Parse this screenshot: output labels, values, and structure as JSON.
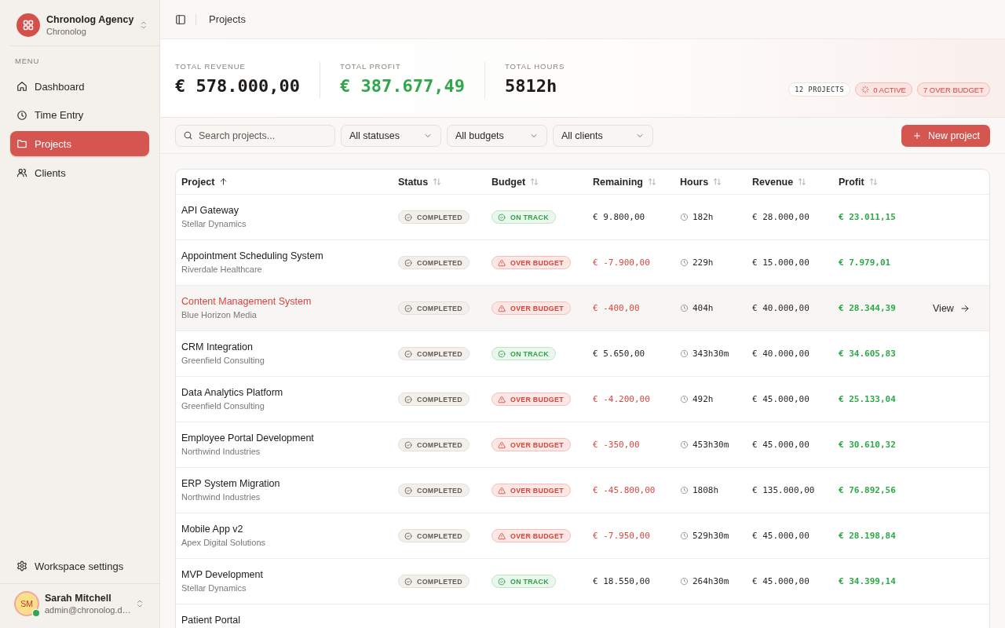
{
  "sidebar": {
    "workspace": {
      "name": "Chronolog Agency",
      "subtitle": "Chronolog"
    },
    "section_label": "MENU",
    "items": [
      {
        "label": "Dashboard",
        "selected": false
      },
      {
        "label": "Time Entry",
        "selected": false
      },
      {
        "label": "Projects",
        "selected": true
      },
      {
        "label": "Clients",
        "selected": false
      }
    ],
    "settings_label": "Workspace settings",
    "user": {
      "initials": "SM",
      "name": "Sarah Mitchell",
      "email": "admin@chronolog.d…",
      "online": true
    }
  },
  "header": {
    "title": "Projects"
  },
  "stats": [
    {
      "label": "TOTAL REVENUE",
      "value": "€ 578.000,00",
      "kind": "neutral"
    },
    {
      "label": "TOTAL PROFIT",
      "value": "€ 387.677,49",
      "kind": "positive"
    },
    {
      "label": "TOTAL HOURS",
      "value": "5812h",
      "kind": "neutral"
    }
  ],
  "summary_badges": [
    {
      "label": "12 PROJECTS",
      "kind": "count"
    },
    {
      "label": "0 ACTIVE",
      "kind": "active"
    },
    {
      "label": "7 OVER BUDGET",
      "kind": "over_budget"
    }
  ],
  "filters": {
    "search": {
      "placeholder": "Search projects..."
    },
    "selects": [
      "All statuses",
      "All budgets",
      "All clients"
    ],
    "new_button": "New project"
  },
  "table": {
    "columns": [
      {
        "label": "Project",
        "sorted": true
      },
      {
        "label": "Status",
        "sorted": false
      },
      {
        "label": "Budget",
        "sorted": false
      },
      {
        "label": "Remaining",
        "sorted": false
      },
      {
        "label": "Hours",
        "sorted": false
      },
      {
        "label": "Revenue",
        "sorted": false
      },
      {
        "label": "Profit",
        "sorted": false
      }
    ],
    "rows": [
      {
        "name": "API Gateway",
        "client": "Stellar Dynamics",
        "status": {
          "label": "COMPLETED",
          "kind": "completed"
        },
        "budget": {
          "label": "ON TRACK",
          "kind": "on_track"
        },
        "remaining": "€ 9.800,00",
        "hours": "182h",
        "revenue": "€ 28.000,00",
        "profit": "€ 23.011,15",
        "hovered": false
      },
      {
        "name": "Appointment Scheduling System",
        "client": "Riverdale Healthcare",
        "status": {
          "label": "COMPLETED",
          "kind": "completed"
        },
        "budget": {
          "label": "OVER BUDGET",
          "kind": "over_budget"
        },
        "remaining": "€ -7.900,00",
        "hours": "229h",
        "revenue": "€ 15.000,00",
        "profit": "€ 7.979,01",
        "hovered": false
      },
      {
        "name": "Content Management System",
        "client": "Blue Horizon Media",
        "status": {
          "label": "COMPLETED",
          "kind": "completed"
        },
        "budget": {
          "label": "OVER BUDGET",
          "kind": "over_budget"
        },
        "remaining": "€ -400,00",
        "hours": "404h",
        "revenue": "€ 40.000,00",
        "profit": "€ 28.344,39",
        "hovered": true,
        "action": "View"
      },
      {
        "name": "CRM Integration",
        "client": "Greenfield Consulting",
        "status": {
          "label": "COMPLETED",
          "kind": "completed"
        },
        "budget": {
          "label": "ON TRACK",
          "kind": "on_track"
        },
        "remaining": "€ 5.650,00",
        "hours": "343h30m",
        "revenue": "€ 40.000,00",
        "profit": "€ 34.605,83",
        "hovered": false
      },
      {
        "name": "Data Analytics Platform",
        "client": "Greenfield Consulting",
        "status": {
          "label": "COMPLETED",
          "kind": "completed"
        },
        "budget": {
          "label": "OVER BUDGET",
          "kind": "over_budget"
        },
        "remaining": "€ -4.200,00",
        "hours": "492h",
        "revenue": "€ 45.000,00",
        "profit": "€ 25.133,04",
        "hovered": false
      },
      {
        "name": "Employee Portal Development",
        "client": "Northwind Industries",
        "status": {
          "label": "COMPLETED",
          "kind": "completed"
        },
        "budget": {
          "label": "OVER BUDGET",
          "kind": "over_budget"
        },
        "remaining": "€ -350,00",
        "hours": "453h30m",
        "revenue": "€ 45.000,00",
        "profit": "€ 30.610,32",
        "hovered": false
      },
      {
        "name": "ERP System Migration",
        "client": "Northwind Industries",
        "status": {
          "label": "COMPLETED",
          "kind": "completed"
        },
        "budget": {
          "label": "OVER BUDGET",
          "kind": "over_budget"
        },
        "remaining": "€ -45.800,00",
        "hours": "1808h",
        "revenue": "€ 135.000,00",
        "profit": "€ 76.892,56",
        "hovered": false
      },
      {
        "name": "Mobile App v2",
        "client": "Apex Digital Solutions",
        "status": {
          "label": "COMPLETED",
          "kind": "completed"
        },
        "budget": {
          "label": "OVER BUDGET",
          "kind": "over_budget"
        },
        "remaining": "€ -7.950,00",
        "hours": "529h30m",
        "revenue": "€ 45.000,00",
        "profit": "€ 28.198,84",
        "hovered": false
      },
      {
        "name": "MVP Development",
        "client": "Stellar Dynamics",
        "status": {
          "label": "COMPLETED",
          "kind": "completed"
        },
        "budget": {
          "label": "ON TRACK",
          "kind": "on_track"
        },
        "remaining": "€ 18.550,00",
        "hours": "264h30m",
        "revenue": "€ 45.000,00",
        "profit": "€ 34.399,14",
        "hovered": false
      },
      {
        "name": "Patient Portal",
        "hovered": false
      }
    ]
  }
}
